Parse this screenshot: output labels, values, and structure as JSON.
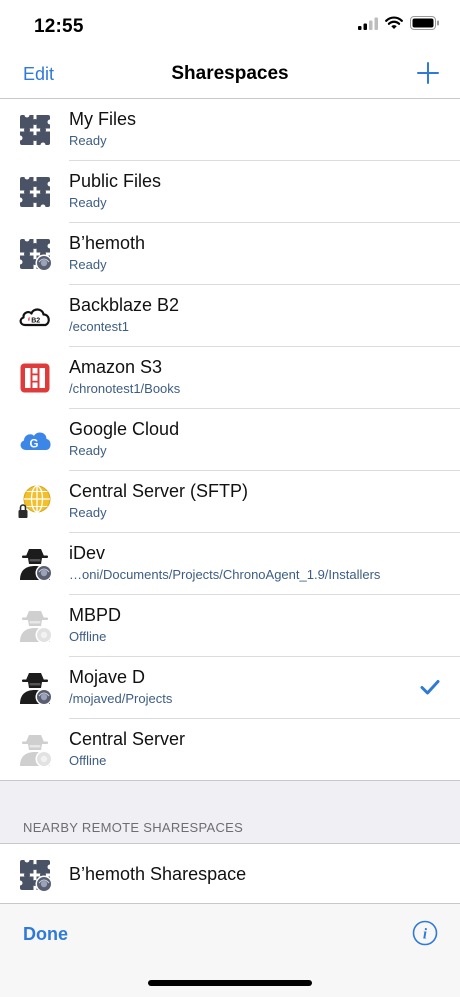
{
  "status": {
    "time": "12:55"
  },
  "nav": {
    "edit_label": "Edit",
    "title": "Sharespaces"
  },
  "colors": {
    "accent": "#2f7ad8",
    "subtitle": "#3d5d83"
  },
  "rows": [
    {
      "title": "My Files",
      "subtitle": "Ready",
      "icon": "puzzle-icon"
    },
    {
      "title": "Public Files",
      "subtitle": "Ready",
      "icon": "puzzle-icon"
    },
    {
      "title": "B’hemoth",
      "subtitle": "Ready",
      "icon": "puzzle-remote-icon"
    },
    {
      "title": "Backblaze B2",
      "subtitle": "/econtest1",
      "icon": "backblaze-b2-icon"
    },
    {
      "title": "Amazon S3",
      "subtitle": "/chronotest1/Books",
      "icon": "amazon-s3-icon"
    },
    {
      "title": "Google Cloud",
      "subtitle": "Ready",
      "icon": "google-cloud-icon"
    },
    {
      "title": "Central Server (SFTP)",
      "subtitle": "Ready",
      "icon": "globe-lock-icon"
    },
    {
      "title": "iDev",
      "subtitle": "…oni/Documents/Projects/ChronoAgent_1.9/Installers",
      "icon": "agent-icon"
    },
    {
      "title": "MBPD",
      "subtitle": "Offline",
      "icon": "agent-offline-icon"
    },
    {
      "title": "Mojave D",
      "subtitle": "/mojaved/Projects",
      "icon": "agent-icon",
      "selected": true
    },
    {
      "title": "Central Server",
      "subtitle": "Offline",
      "icon": "agent-offline-icon"
    }
  ],
  "nearby": {
    "header": "NEARBY REMOTE SHARESPACES",
    "item_title": "B’hemoth Sharespace",
    "icon": "puzzle-remote-icon"
  },
  "toolbar": {
    "done_label": "Done"
  }
}
